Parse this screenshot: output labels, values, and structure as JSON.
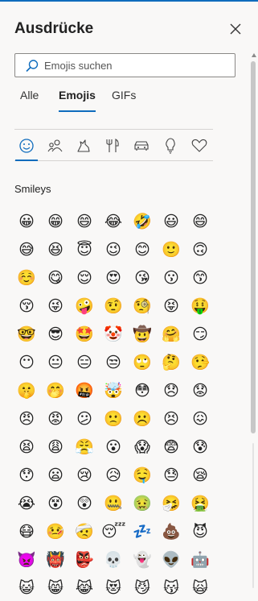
{
  "header": {
    "title": "Ausdrücke",
    "close_icon": "close-icon"
  },
  "search": {
    "placeholder": "Emojis suchen",
    "value": "",
    "icon": "search-icon"
  },
  "tabs": [
    {
      "label": "Alle",
      "active": false
    },
    {
      "label": "Emojis",
      "active": true
    },
    {
      "label": "GIFs",
      "active": false
    }
  ],
  "categories": [
    {
      "icon": "smiley-icon",
      "active": true
    },
    {
      "icon": "people-icon",
      "active": false
    },
    {
      "icon": "animals-icon",
      "active": false
    },
    {
      "icon": "food-icon",
      "active": false
    },
    {
      "icon": "travel-icon",
      "active": false
    },
    {
      "icon": "lightbulb-icon",
      "active": false
    },
    {
      "icon": "heart-icon",
      "active": false
    }
  ],
  "section": {
    "title": "Smileys"
  },
  "emojis": [
    [
      "😀",
      "😁",
      "😄",
      "😂",
      "🤣",
      "😃",
      "😄"
    ],
    [
      "😅",
      "😆",
      "😇",
      "😉",
      "😊",
      "🙂",
      "🙃"
    ],
    [
      "☺️",
      "😋",
      "😌",
      "😍",
      "😘",
      "😗",
      "😙"
    ],
    [
      "😚",
      "😜",
      "🤪",
      "🤨",
      "🧐",
      "😝",
      "🤑"
    ],
    [
      "🤓",
      "😎",
      "🤩",
      "🤡",
      "🤠",
      "🤗",
      "😏"
    ],
    [
      "😶",
      "😐",
      "😑",
      "😒",
      "🙄",
      "🤔",
      "🤥"
    ],
    [
      "🤫",
      "🤭",
      "🤬",
      "🤯",
      "😳",
      "😞",
      "😟"
    ],
    [
      "😠",
      "😡",
      "😕",
      "🙁",
      "☹️",
      "😣",
      "😖"
    ],
    [
      "😫",
      "😩",
      "😤",
      "😮",
      "😱",
      "😨",
      "😰"
    ],
    [
      "😯",
      "😦",
      "😢",
      "😥",
      "🤤",
      "😓",
      "😪"
    ],
    [
      "😭",
      "😵",
      "😲",
      "🤐",
      "🤢",
      "🤧",
      "🤮"
    ],
    [
      "😷",
      "🤒",
      "🤕",
      "😴",
      "💤",
      "💩",
      "😈"
    ],
    [
      "👿",
      "👹",
      "👺",
      "💀",
      "👻",
      "👽",
      "🤖"
    ],
    [
      "😺",
      "😸",
      "😹",
      "😻",
      "😼",
      "😽",
      "🙀"
    ]
  ]
}
